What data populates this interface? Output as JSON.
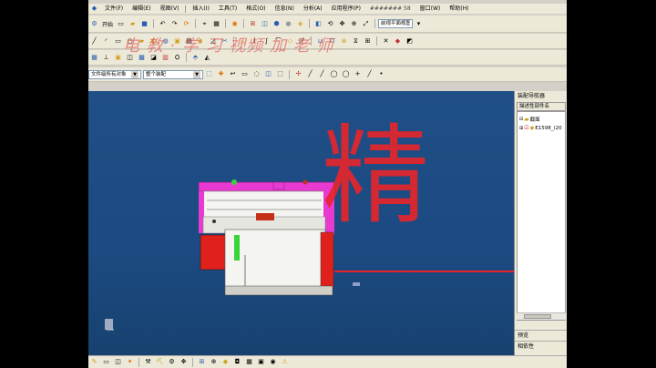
{
  "menu": [
    "文件(F)",
    "编辑(E)",
    "视图(V)",
    "插入(I)",
    "工具(T)",
    "格式(O)",
    "信息(N)",
    "分析(A)",
    "应用程序(P)",
    "窗口(W)",
    "帮助(H)"
  ],
  "menu_toolbar_text": "####### 58",
  "toolbar": {
    "open_label": "开始",
    "view_label": "前视平面视图"
  },
  "filter_combo": {
    "value": "文件级所有对象"
  },
  "select_combo": {
    "value": "整个装配"
  },
  "watermark_text": "电   教   ·   学   习   视频   加   老   师   ",
  "annotation_char": "精",
  "panel": {
    "title": "装配导航器",
    "column_header": "描述性部件名",
    "tree": [
      {
        "label": "截面",
        "icon": "folder-icon"
      },
      {
        "label": "E1598_(20",
        "icon": "part-icon"
      }
    ],
    "section_prefs": "预览",
    "section_related": "相依性"
  },
  "colors": {
    "viewport_bg": "#1c4a82",
    "annotation_red": "#e8252a",
    "mold_magenta": "#e83ad0",
    "mold_red": "#e0201a",
    "mold_white": "#f4f4f0",
    "mold_green": "#39d439"
  }
}
